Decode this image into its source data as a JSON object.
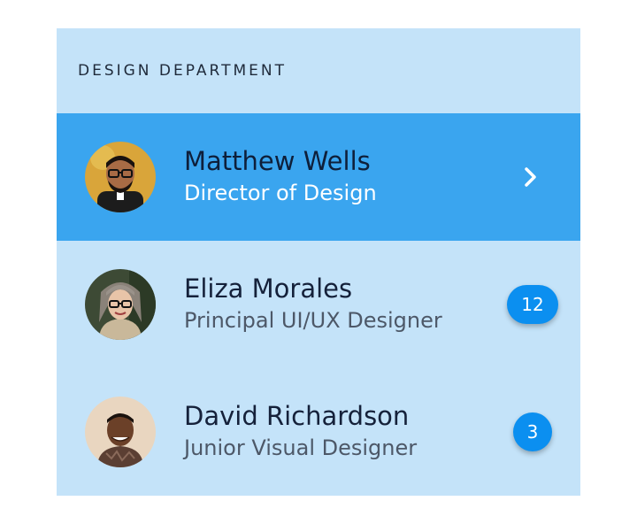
{
  "department": {
    "title": "DESIGN DEPARTMENT"
  },
  "people": [
    {
      "name": "Matthew Wells",
      "title": "Director of Design",
      "selected": true,
      "action_icon": "chevron-right-icon"
    },
    {
      "name": "Eliza Morales",
      "title": "Principal UI/UX Designer",
      "badge": "12"
    },
    {
      "name": "David Richardson",
      "title": "Junior Visual Designer",
      "badge": "3"
    }
  ],
  "colors": {
    "card_background": "#c4e3f9",
    "selected_row": "#3aa5ef",
    "badge": "#0b8ff0"
  }
}
